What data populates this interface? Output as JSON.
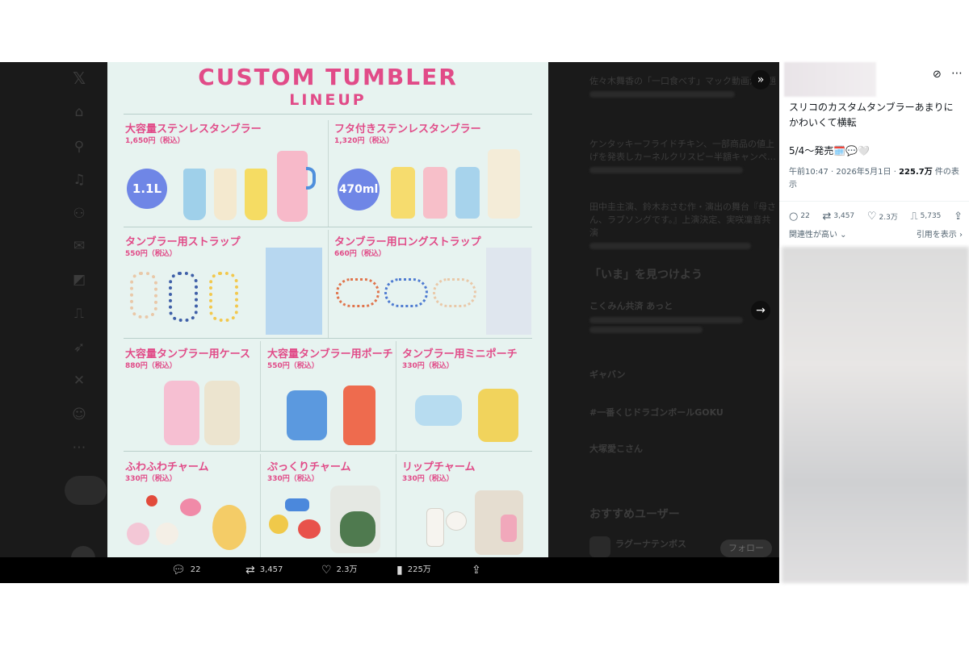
{
  "image": {
    "title_line1": "CUSTOM TUMBLER",
    "title_line2": "LINEUP",
    "products": [
      {
        "name": "大容量ステンレスタンブラー",
        "price": "1,650円（税込）",
        "badge": "1.1L"
      },
      {
        "name": "フタ付きステンレスタンブラー",
        "price": "1,320円（税込）",
        "badge": "470ml"
      },
      {
        "name": "タンブラー用ストラップ",
        "price": "550円（税込）"
      },
      {
        "name": "タンブラー用ロングストラップ",
        "price": "660円（税込）"
      },
      {
        "name": "大容量タンブラー用ケース",
        "price": "880円（税込）"
      },
      {
        "name": "大容量タンブラー用ポーチ",
        "price": "550円（税込）"
      },
      {
        "name": "タンブラー用ミニポーチ",
        "price": "330円（税込）"
      },
      {
        "name": "ふわふわチャーム",
        "price": "330円（税込）"
      },
      {
        "name": "ぷっくりチャーム",
        "price": "330円（税込）"
      },
      {
        "name": "リップチャーム",
        "price": "330円（税込）"
      }
    ]
  },
  "action_bar": {
    "replies": "22",
    "reposts": "3,457",
    "likes": "2.3万",
    "views": "225万"
  },
  "background_sidebar": {
    "trend1": "佐々木舞香の「一口食べす」マック動画が話題",
    "trend2": "ケンタッキーフライドチキン、一部商品の値上げを発表しカーネルクリスピー半額キャンペ…",
    "trend3": "田中圭主演、鈴木おさむ作・演出の舞台『母さん、ラブソングです。』上演決定、実咲凜音共演",
    "explore_heading": "「いま」を見つけよう",
    "news": "こくみん共済 あっと",
    "trend_a": "ギャバン",
    "trend_b": "#一番くじドラゴンボールGOKU",
    "trend_c": "大塚愛こさん",
    "recommended_heading": "おすすめユーザー",
    "user1": "ラグーナテンボス",
    "follow_label": "フォロー"
  },
  "post_panel": {
    "text_line1": "スリコのカスタムタンブラーあまりに",
    "text_line2": "かわいくて横転",
    "text_line3": "5/4〜発売🗓️💬🤍",
    "time_date": "午前10:47 · 2026年5月1日 · ",
    "view_count": "225.7万",
    "view_suffix": " 件の表示",
    "stats": {
      "replies": "22",
      "reposts": "3,457",
      "likes": "2.3万",
      "bookmarks": "5,735"
    },
    "relevance_label": "関連性が高い",
    "quotes_label": "引用を表示"
  },
  "colors": {
    "accent_pink": "#e14b88",
    "image_bg": "#e7f3f0",
    "viewer_bg": "#1a1a1a"
  },
  "icons": [
    "x-logo-icon",
    "home-icon",
    "search-icon",
    "bell-icon",
    "people-icon",
    "message-icon",
    "grok-icon",
    "bookmark-icon",
    "rocket-icon",
    "x-premium-icon",
    "profile-icon",
    "more-icon",
    "expand-icon",
    "arrow-right-icon",
    "reply-icon",
    "repost-icon",
    "like-icon",
    "views-icon",
    "share-icon",
    "bookmark-icon",
    "translate-icon"
  ]
}
